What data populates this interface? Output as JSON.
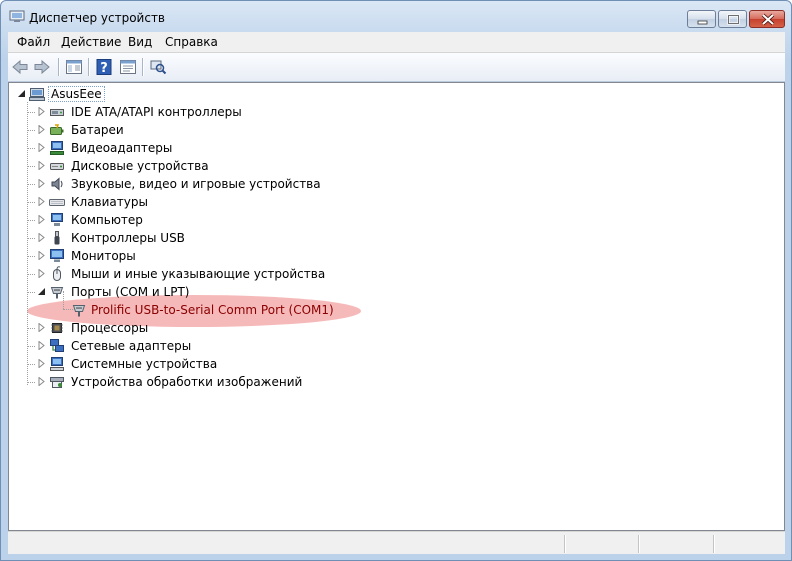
{
  "window": {
    "title": "Диспетчер устройств"
  },
  "menu": [
    "Файл",
    "Действие",
    "Вид",
    "Справка"
  ],
  "toolbar": {
    "buttons": [
      "back-arrow-icon",
      "forward-arrow-icon",
      "show-hide-console-tree-icon",
      "help-icon",
      "properties-icon",
      "scan-hardware-icon"
    ]
  },
  "tree": {
    "root": "AsusEee",
    "categories": [
      {
        "label": "IDE ATA/ATAPI контроллеры",
        "icon": "ide-controller-icon",
        "expanded": false
      },
      {
        "label": "Батареи",
        "icon": "battery-icon",
        "expanded": false
      },
      {
        "label": "Видеоадаптеры",
        "icon": "display-adapter-icon",
        "expanded": false
      },
      {
        "label": "Дисковые устройства",
        "icon": "disk-drive-icon",
        "expanded": false
      },
      {
        "label": "Звуковые, видео и игровые устройства",
        "icon": "speaker-icon",
        "expanded": false
      },
      {
        "label": "Клавиатуры",
        "icon": "keyboard-icon",
        "expanded": false
      },
      {
        "label": "Компьютер",
        "icon": "computer-icon",
        "expanded": false
      },
      {
        "label": "Контроллеры USB",
        "icon": "usb-icon",
        "expanded": false
      },
      {
        "label": "Мониторы",
        "icon": "monitor-icon",
        "expanded": false
      },
      {
        "label": "Мыши и иные указывающие устройства",
        "icon": "mouse-icon",
        "expanded": false
      },
      {
        "label": "Порты (COM и LPT)",
        "icon": "port-icon",
        "expanded": true,
        "children": [
          {
            "label": "Prolific USB-to-Serial Comm Port (COM1)",
            "icon": "port-icon"
          }
        ]
      },
      {
        "label": "Процессоры",
        "icon": "processor-icon",
        "expanded": false
      },
      {
        "label": "Сетевые адаптеры",
        "icon": "network-adapter-icon",
        "expanded": false
      },
      {
        "label": "Системные устройства",
        "icon": "system-device-icon",
        "expanded": false
      },
      {
        "label": "Устройства обработки изображений",
        "icon": "imaging-device-icon",
        "expanded": false
      }
    ]
  },
  "colors": {
    "highlight": "#ef8080",
    "child_text": "#8a0000"
  }
}
